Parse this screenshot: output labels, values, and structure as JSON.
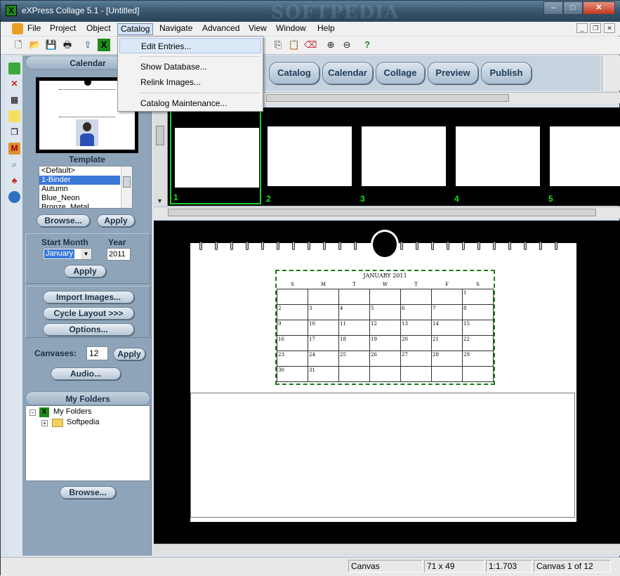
{
  "app": {
    "title": "eXPress Collage 5.1 - [Untitled]",
    "watermark": "SOFTPEDIA",
    "icon": "express-collage-icon"
  },
  "window_controls": {
    "minimize": "–",
    "maximize": "□",
    "close": "✕"
  },
  "menu": {
    "items": [
      "File",
      "Project",
      "Object",
      "Catalog",
      "Navigate",
      "Advanced",
      "View",
      "Window",
      "Help"
    ],
    "active": "Catalog"
  },
  "mdi_controls": {
    "minimize": "_",
    "restore": "❐",
    "close": "✕"
  },
  "catalog_menu": {
    "items": [
      "Edit Entries...",
      "Show Database...",
      "Relink Images...",
      "Catalog Maintenance..."
    ]
  },
  "tabs": [
    "Catalog",
    "Calendar",
    "Collage",
    "Preview",
    "Publish"
  ],
  "left_panel": {
    "calendar_title": "Calendar",
    "template_label": "Template",
    "templates": [
      "<Default>",
      "1-Binder",
      "Autumn",
      "Blue_Neon",
      "Bronze_Metal"
    ],
    "selected_template": "1-Binder",
    "browse": "Browse...",
    "apply": "Apply",
    "start_month_label": "Start Month",
    "year_label": "Year",
    "start_month": "January",
    "year": "2011",
    "apply2": "Apply",
    "import_images": "Import Images...",
    "cycle_layout": "Cycle Layout >>>",
    "options": "Options...",
    "canvases_label": "Canvases:",
    "canvases": "12",
    "apply3": "Apply",
    "audio": "Audio...",
    "my_folders_title": "My Folders",
    "folder_root": "My Folders",
    "folder_child": "Softpedia",
    "browse2": "Browse..."
  },
  "thumbnails": [
    "1",
    "2",
    "3",
    "4",
    "5"
  ],
  "calendar": {
    "month_title": "JANUARY  2011",
    "weekdays": [
      "S",
      "M",
      "T",
      "W",
      "T",
      "F",
      "S"
    ],
    "weeks": [
      [
        "",
        "",
        "",
        "",
        "",
        "",
        "1"
      ],
      [
        "2",
        "3",
        "4",
        "5",
        "6",
        "7",
        "8"
      ],
      [
        "9",
        "10",
        "11",
        "12",
        "13",
        "14",
        "15"
      ],
      [
        "16",
        "17",
        "18",
        "19",
        "20",
        "21",
        "22"
      ],
      [
        "23",
        "24",
        "25",
        "26",
        "27",
        "28",
        "29"
      ],
      [
        "30",
        "31",
        "",
        "",
        "",
        "",
        ""
      ]
    ]
  },
  "status": {
    "mode": "Canvas",
    "size": "71 x 49",
    "zoom": "1:1.703",
    "canvas": "Canvas 1 of 12"
  },
  "colors": {
    "accent": "#3b78d8",
    "thumb_number": "#19e019",
    "selected_thumb_border": "#1ed01e"
  }
}
